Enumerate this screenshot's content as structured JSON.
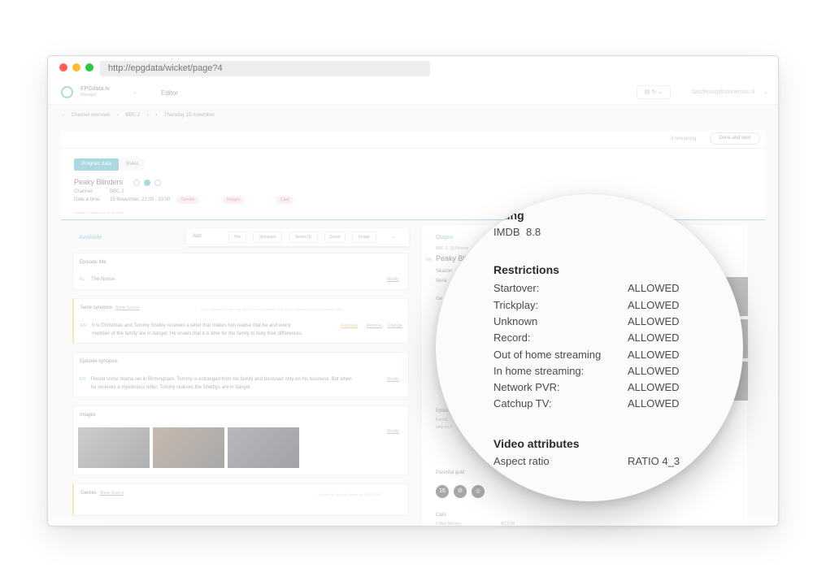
{
  "browser": {
    "url": "http://epgdata/wicket/page?4"
  },
  "header": {
    "brand_name": "EPGdata.tv",
    "brand_sub": "Manager",
    "section": "Editor",
    "user": "basdejong@stoneroos.nl",
    "icons": [
      "document-icon",
      "refresh-icon",
      "chevron-down-icon"
    ]
  },
  "breadcrumb": {
    "channel_overview": "Channel overview",
    "channel": "BBC 2",
    "date": "Thursday 15 november"
  },
  "topbar": {
    "remaining": "3 remaining",
    "done_label": "Done and next"
  },
  "program": {
    "tabs": [
      "Program data",
      "Rules"
    ],
    "title": "Peaky Blinders",
    "channel_label": "Channel:",
    "channel_value": "BBC 2",
    "datetime_label": "Date & time:",
    "datetime_value": "15 November, 22:00 - 23:00",
    "pills": [
      "Genres",
      "Images",
      "Cast"
    ],
    "version": "Version 3 Checked up 11-06-2020"
  },
  "available": {
    "label": "Available",
    "add_label": "Add",
    "add_buttons": [
      "Title",
      "Synopsis",
      "Series ID",
      "Genre",
      "Image"
    ],
    "episode_title": {
      "heading": "Episode title",
      "lang": "NL",
      "text": "The Noose",
      "action": "Modify"
    },
    "serie_synopsis": {
      "heading": "Serie synopsis",
      "show_source": "Show Source",
      "source_meta": "Bulk: Seasons: Sa Mon Tue Wed Thu Fri | Between 19:00 22:00 | Season 2014082 | Episode 1400",
      "lang": "EN",
      "line1": "It is Christmas and Tommy Shelby receives a letter that makes him realise that he and every",
      "line2": "member of the family are in danger. He knows that it is time for the family to bury their differences.",
      "actions": [
        "Automate",
        "Remove",
        "Change"
      ]
    },
    "episode_synopsis": {
      "heading": "Episode synopsis",
      "lang": "EN",
      "line1": "Period crime drama set in Birmingham. Tommy is estranged from his family and focussed only on his business. But when",
      "line2": "he receives a mysterious letter, Tommy realises the Shelbys are in danger.",
      "action": "Modify"
    },
    "images": {
      "heading": "Images",
      "action": "Modify"
    },
    "genres": {
      "heading": "Genres",
      "show_source": "Show Source",
      "meta": "Modified by Manual Change on 20-02-2020"
    }
  },
  "output": {
    "label": "Output",
    "subline": "BBC 2, 15 Novem",
    "title": "Peaky Blind",
    "en": "EN",
    "season_label": "Season",
    "serie_label": "Serie",
    "genre_label": "Ge",
    "episode_label": "Episo",
    "episode_line1": "Period",
    "episode_line2": "only on h",
    "parental_label": "Parental guid",
    "badges": [
      "16",
      "⚙",
      "◎"
    ],
    "cast_label": "Cast",
    "cast_name": "Cillian Murphy",
    "cast_role": "ACTOR"
  },
  "magnifier": {
    "rating_heading_partial": "ting",
    "imdb_label": "IMDB",
    "imdb_value": "8.8",
    "restrictions_heading": "Restrictions",
    "restrictions": [
      {
        "label": "Startover:",
        "value": "ALLOWED"
      },
      {
        "label": "Trickplay:",
        "value": "ALLOWED"
      },
      {
        "label": "Unknown",
        "value": "ALLOWED"
      },
      {
        "label": "Record:",
        "value": "ALLOWED"
      },
      {
        "label": "Out of home streaming",
        "value": "ALLOWED"
      },
      {
        "label": "In home streaming:",
        "value": "ALLOWED"
      },
      {
        "label": "Network PVR:",
        "value": "ALLOWED"
      },
      {
        "label": "Catchup TV:",
        "value": "ALLOWED"
      }
    ],
    "video_heading": "Video attributes",
    "aspect_label": "Aspect ratio",
    "aspect_value": "RATIO 4_3"
  },
  "colors": {
    "accent": "#3aa5b8",
    "pill_bg": "#f3dfe3",
    "highlight": "#f2c94c"
  }
}
